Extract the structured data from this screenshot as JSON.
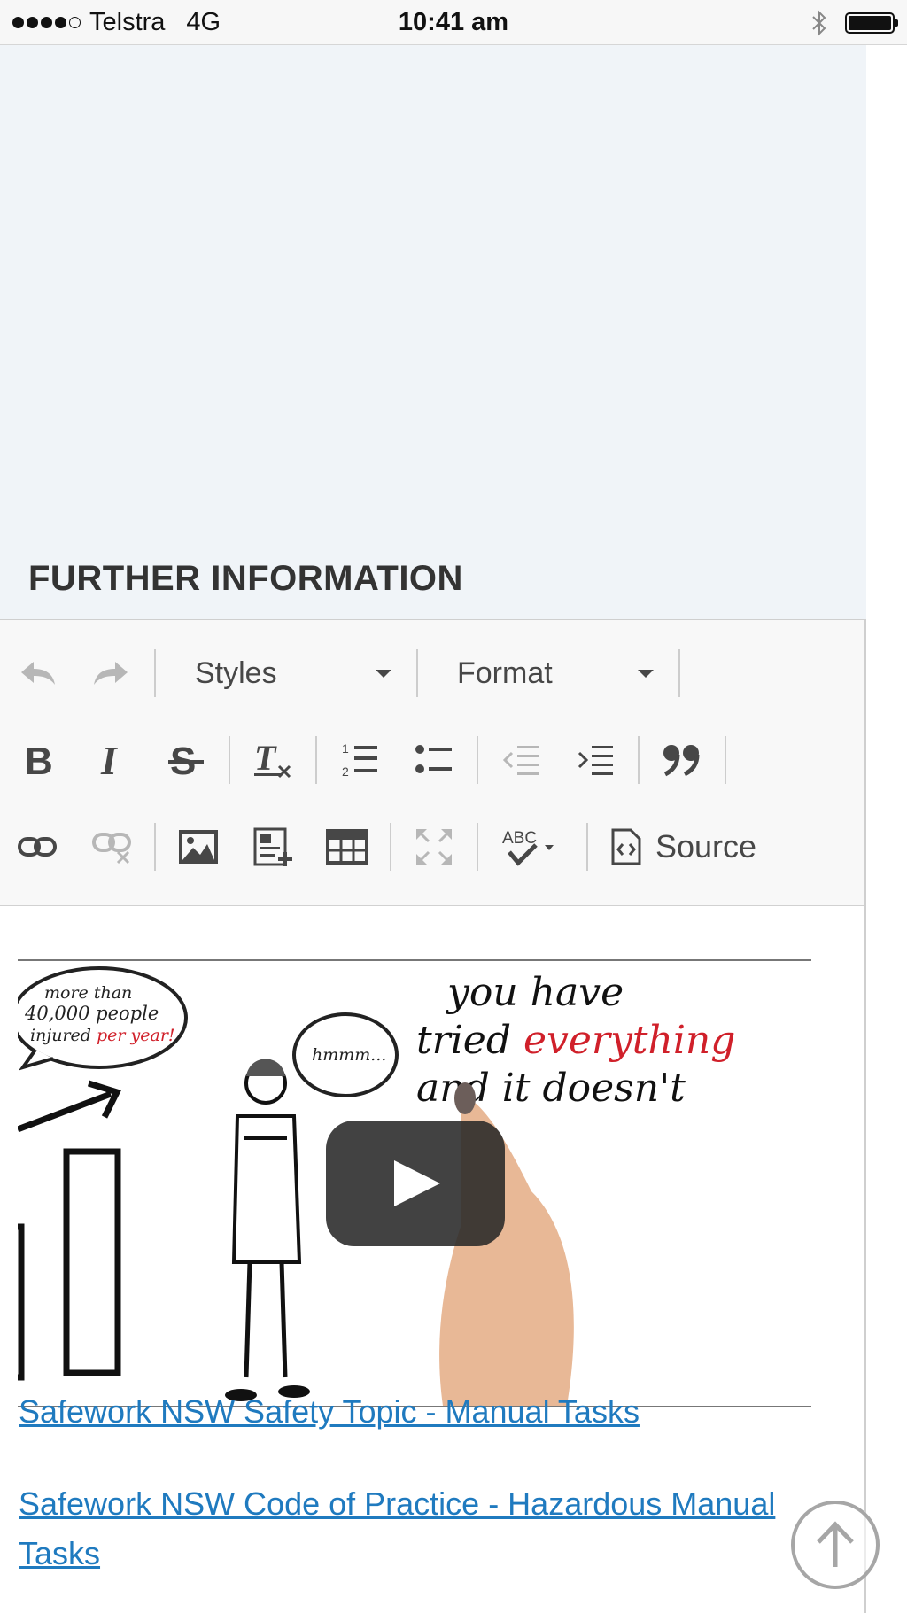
{
  "status_bar": {
    "carrier": "Telstra",
    "network": "4G",
    "time": "10:41 am"
  },
  "section": {
    "title": "FURTHER INFORMATION"
  },
  "toolbar": {
    "styles_label": "Styles",
    "format_label": "Format",
    "source_label": "Source"
  },
  "video": {
    "speech_bubble_left": "more than 40,000 people injured per year!",
    "speech_bubble_mid": "hmmm...",
    "handwriting_line1": "you have",
    "handwriting_line2_a": "tried ",
    "handwriting_line2_b": "everything",
    "handwriting_line3": "and it doesn't"
  },
  "links": [
    {
      "label": "Safework NSW Safety Topic - Manual Tasks"
    },
    {
      "label": "Safework NSW Code of Practice - Hazardous Manual Tasks"
    }
  ],
  "colors": {
    "accent_link": "#1f7abf",
    "panel_bg": "#f0f4f8",
    "highlight_red": "#d0202a"
  }
}
